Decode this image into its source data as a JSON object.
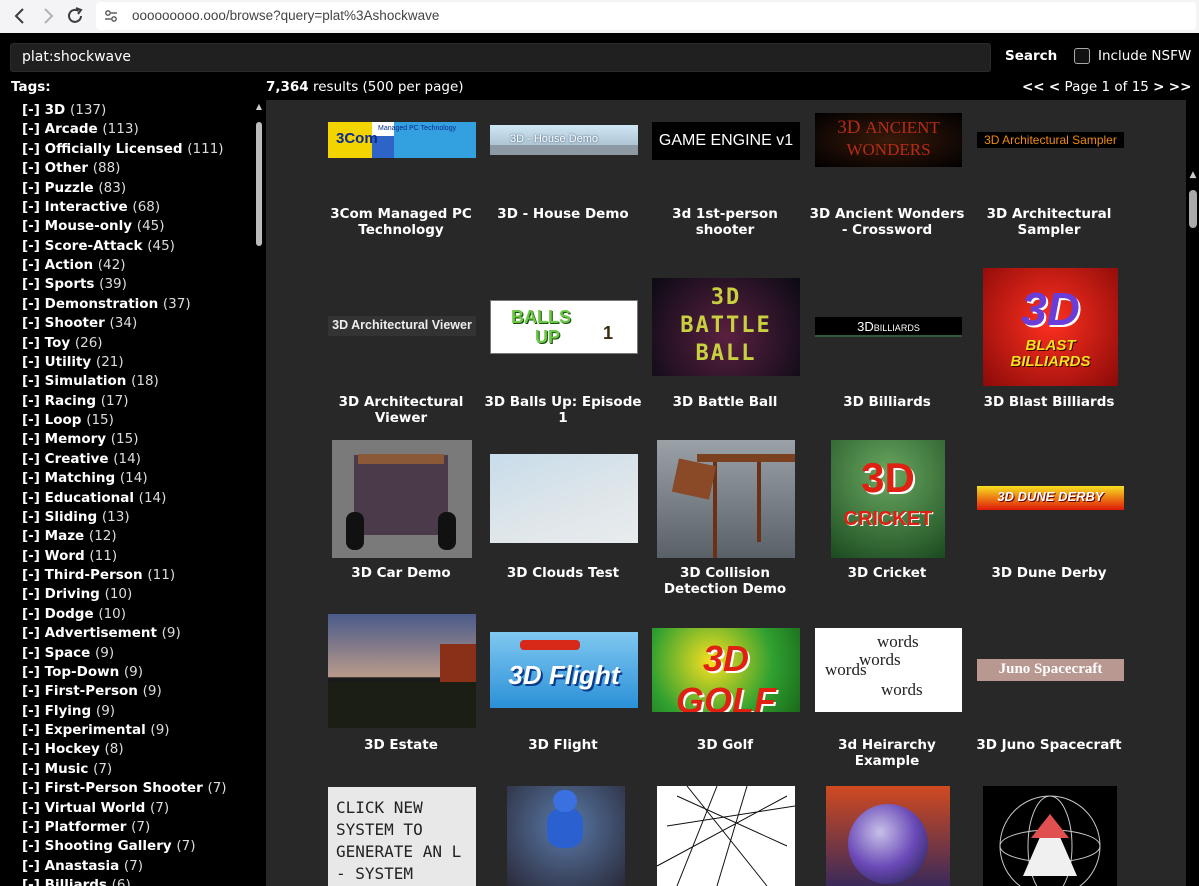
{
  "browser": {
    "url": "ooooooooo.ooo/browse?query=plat%3Ashockwave"
  },
  "search": {
    "value": "plat:shockwave",
    "button_label": "Search",
    "nsfw_label": "Include NSFW"
  },
  "sidebar": {
    "title": "Tags:",
    "tags": [
      {
        "toggle": "[-]",
        "name": "3D",
        "count": "(137)"
      },
      {
        "toggle": "[-]",
        "name": "Arcade",
        "count": "(113)"
      },
      {
        "toggle": "[-]",
        "name": "Officially Licensed",
        "count": "(111)"
      },
      {
        "toggle": "[-]",
        "name": "Other",
        "count": "(88)"
      },
      {
        "toggle": "[-]",
        "name": "Puzzle",
        "count": "(83)"
      },
      {
        "toggle": "[-]",
        "name": "Interactive",
        "count": "(68)"
      },
      {
        "toggle": "[-]",
        "name": "Mouse-only",
        "count": "(45)"
      },
      {
        "toggle": "[-]",
        "name": "Score-Attack",
        "count": "(45)"
      },
      {
        "toggle": "[-]",
        "name": "Action",
        "count": "(42)"
      },
      {
        "toggle": "[-]",
        "name": "Sports",
        "count": "(39)"
      },
      {
        "toggle": "[-]",
        "name": "Demonstration",
        "count": "(37)"
      },
      {
        "toggle": "[-]",
        "name": "Shooter",
        "count": "(34)"
      },
      {
        "toggle": "[-]",
        "name": "Toy",
        "count": "(26)"
      },
      {
        "toggle": "[-]",
        "name": "Utility",
        "count": "(21)"
      },
      {
        "toggle": "[-]",
        "name": "Simulation",
        "count": "(18)"
      },
      {
        "toggle": "[-]",
        "name": "Racing",
        "count": "(17)"
      },
      {
        "toggle": "[-]",
        "name": "Loop",
        "count": "(15)"
      },
      {
        "toggle": "[-]",
        "name": "Memory",
        "count": "(15)"
      },
      {
        "toggle": "[-]",
        "name": "Creative",
        "count": "(14)"
      },
      {
        "toggle": "[-]",
        "name": "Matching",
        "count": "(14)"
      },
      {
        "toggle": "[-]",
        "name": "Educational",
        "count": "(14)"
      },
      {
        "toggle": "[-]",
        "name": "Sliding",
        "count": "(13)"
      },
      {
        "toggle": "[-]",
        "name": "Maze",
        "count": "(12)"
      },
      {
        "toggle": "[-]",
        "name": "Word",
        "count": "(11)"
      },
      {
        "toggle": "[-]",
        "name": "Third-Person",
        "count": "(11)"
      },
      {
        "toggle": "[-]",
        "name": "Driving",
        "count": "(10)"
      },
      {
        "toggle": "[-]",
        "name": "Dodge",
        "count": "(10)"
      },
      {
        "toggle": "[-]",
        "name": "Advertisement",
        "count": "(9)"
      },
      {
        "toggle": "[-]",
        "name": "Space",
        "count": "(9)"
      },
      {
        "toggle": "[-]",
        "name": "Top-Down",
        "count": "(9)"
      },
      {
        "toggle": "[-]",
        "name": "First-Person",
        "count": "(9)"
      },
      {
        "toggle": "[-]",
        "name": "Flying",
        "count": "(9)"
      },
      {
        "toggle": "[-]",
        "name": "Experimental",
        "count": "(9)"
      },
      {
        "toggle": "[-]",
        "name": "Hockey",
        "count": "(8)"
      },
      {
        "toggle": "[-]",
        "name": "Music",
        "count": "(7)"
      },
      {
        "toggle": "[-]",
        "name": "First-Person Shooter",
        "count": "(7)"
      },
      {
        "toggle": "[-]",
        "name": "Virtual World",
        "count": "(7)"
      },
      {
        "toggle": "[-]",
        "name": "Platformer",
        "count": "(7)"
      },
      {
        "toggle": "[-]",
        "name": "Shooting Gallery",
        "count": "(7)"
      },
      {
        "toggle": "[-]",
        "name": "Anastasia",
        "count": "(7)"
      },
      {
        "toggle": "[-]",
        "name": "Billiards",
        "count": "(6)"
      }
    ]
  },
  "results": {
    "count": "7,364",
    "suffix": "results (500 per page)"
  },
  "pager": {
    "first": "<<",
    "prev": "<",
    "page_label": "Page 1 of 15",
    "next": ">",
    "last": ">>"
  },
  "games": [
    {
      "title": "3Com Managed PC Technology",
      "thumb_text": "3Com  Managed PC Technology"
    },
    {
      "title": "3D - House Demo",
      "thumb_text": "3D - House Demo"
    },
    {
      "title": "3d 1st-person shooter",
      "thumb_text": "GAME ENGINE v1"
    },
    {
      "title": "3D Ancient Wonders - Crossword",
      "thumb_text": "3D ANCIENT WONDERS"
    },
    {
      "title": "3D Architectural Sampler",
      "thumb_text": "3D Architectural Sampler"
    },
    {
      "title": "3D Architectural Viewer",
      "thumb_text": "3D Architectural Viewer"
    },
    {
      "title": "3D Balls Up: Episode 1",
      "thumb_text": "BALLS UP"
    },
    {
      "title": "3D Battle Ball",
      "thumb_text": "3D BATTLE BALL"
    },
    {
      "title": "3D Billiards",
      "thumb_text": "3D BILLIARDS"
    },
    {
      "title": "3D Blast Billiards",
      "thumb_text": "3D BLAST BILLIARDS"
    },
    {
      "title": "3D Car Demo",
      "thumb_text": ""
    },
    {
      "title": "3D Clouds Test",
      "thumb_text": ""
    },
    {
      "title": "3D Collision Detection Demo",
      "thumb_text": ""
    },
    {
      "title": "3D Cricket",
      "thumb_text": "3D CRICKET"
    },
    {
      "title": "3D Dune Derby",
      "thumb_text": "3D DUNE DERBY"
    },
    {
      "title": "3D Estate",
      "thumb_text": ""
    },
    {
      "title": "3D Flight",
      "thumb_text": "3D Flight"
    },
    {
      "title": "3D Golf",
      "thumb_text": "3D GOLF"
    },
    {
      "title": "3d Heirarchy Example",
      "thumb_text": "words words words words"
    },
    {
      "title": "3D Juno Spacecraft",
      "thumb_text": "Juno Spacecraft"
    },
    {
      "title": "",
      "thumb_text": "CLICK NEW SYSTEM TO GENERATE AN L - SYSTEM"
    },
    {
      "title": "",
      "thumb_text": ""
    },
    {
      "title": "",
      "thumb_text": ""
    },
    {
      "title": "",
      "thumb_text": ""
    },
    {
      "title": "",
      "thumb_text": ""
    }
  ]
}
